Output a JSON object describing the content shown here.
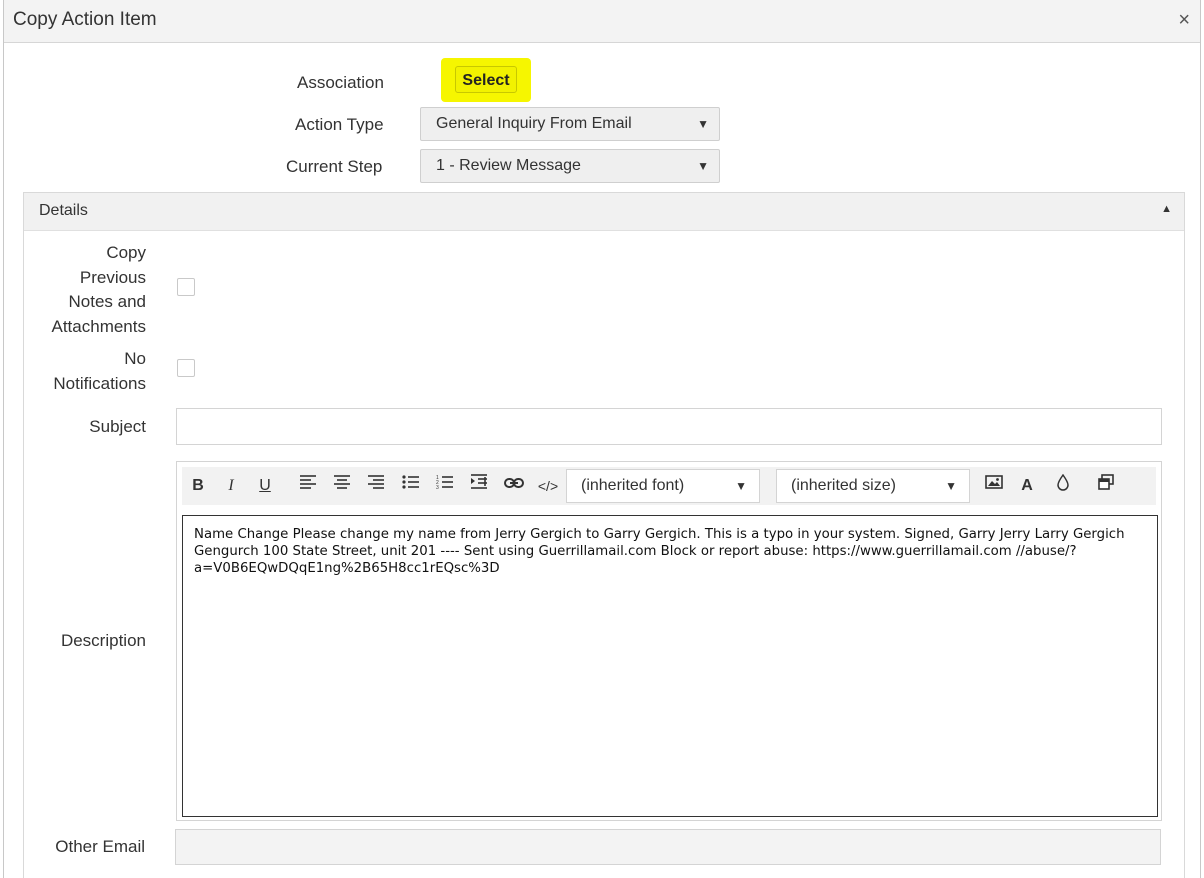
{
  "dialog": {
    "title": "Copy Action Item",
    "close_icon": "×"
  },
  "form": {
    "association_label": "Association",
    "select_button_label": "Select",
    "action_type_label": "Action Type",
    "action_type_value": "General Inquiry From Email",
    "current_step_label": "Current Step",
    "current_step_value": "1 - Review Message"
  },
  "details": {
    "header_label": "Details",
    "copy_notes_label_lines": [
      "Copy",
      "Previous",
      "Notes and",
      "Attachments"
    ],
    "no_notifications_label_lines": [
      "No",
      "Notifications"
    ],
    "subject_label": "Subject",
    "subject_value": "",
    "description_label": "Description",
    "toolbar": {
      "font_value": "(inherited font)",
      "size_value": "(inherited size)"
    },
    "description_text": "Name Change Please change my name from Jerry Gergich to Garry Gergich. This is a typo in your system. Signed, Garry Jerry Larry Gergich Gengurch 100 State Street, unit 201 ---- Sent using Guerrillamail.com Block or report abuse: https://www.guerrillamail.com //abuse/?a=V0B6EQwDQqE1ng%2B65H8cc1rEQsc%3D",
    "other_email_label": "Other Email",
    "other_email_value": ""
  },
  "colors": {
    "highlight": "#f6f600",
    "panel_header": "#f1f1f1"
  }
}
